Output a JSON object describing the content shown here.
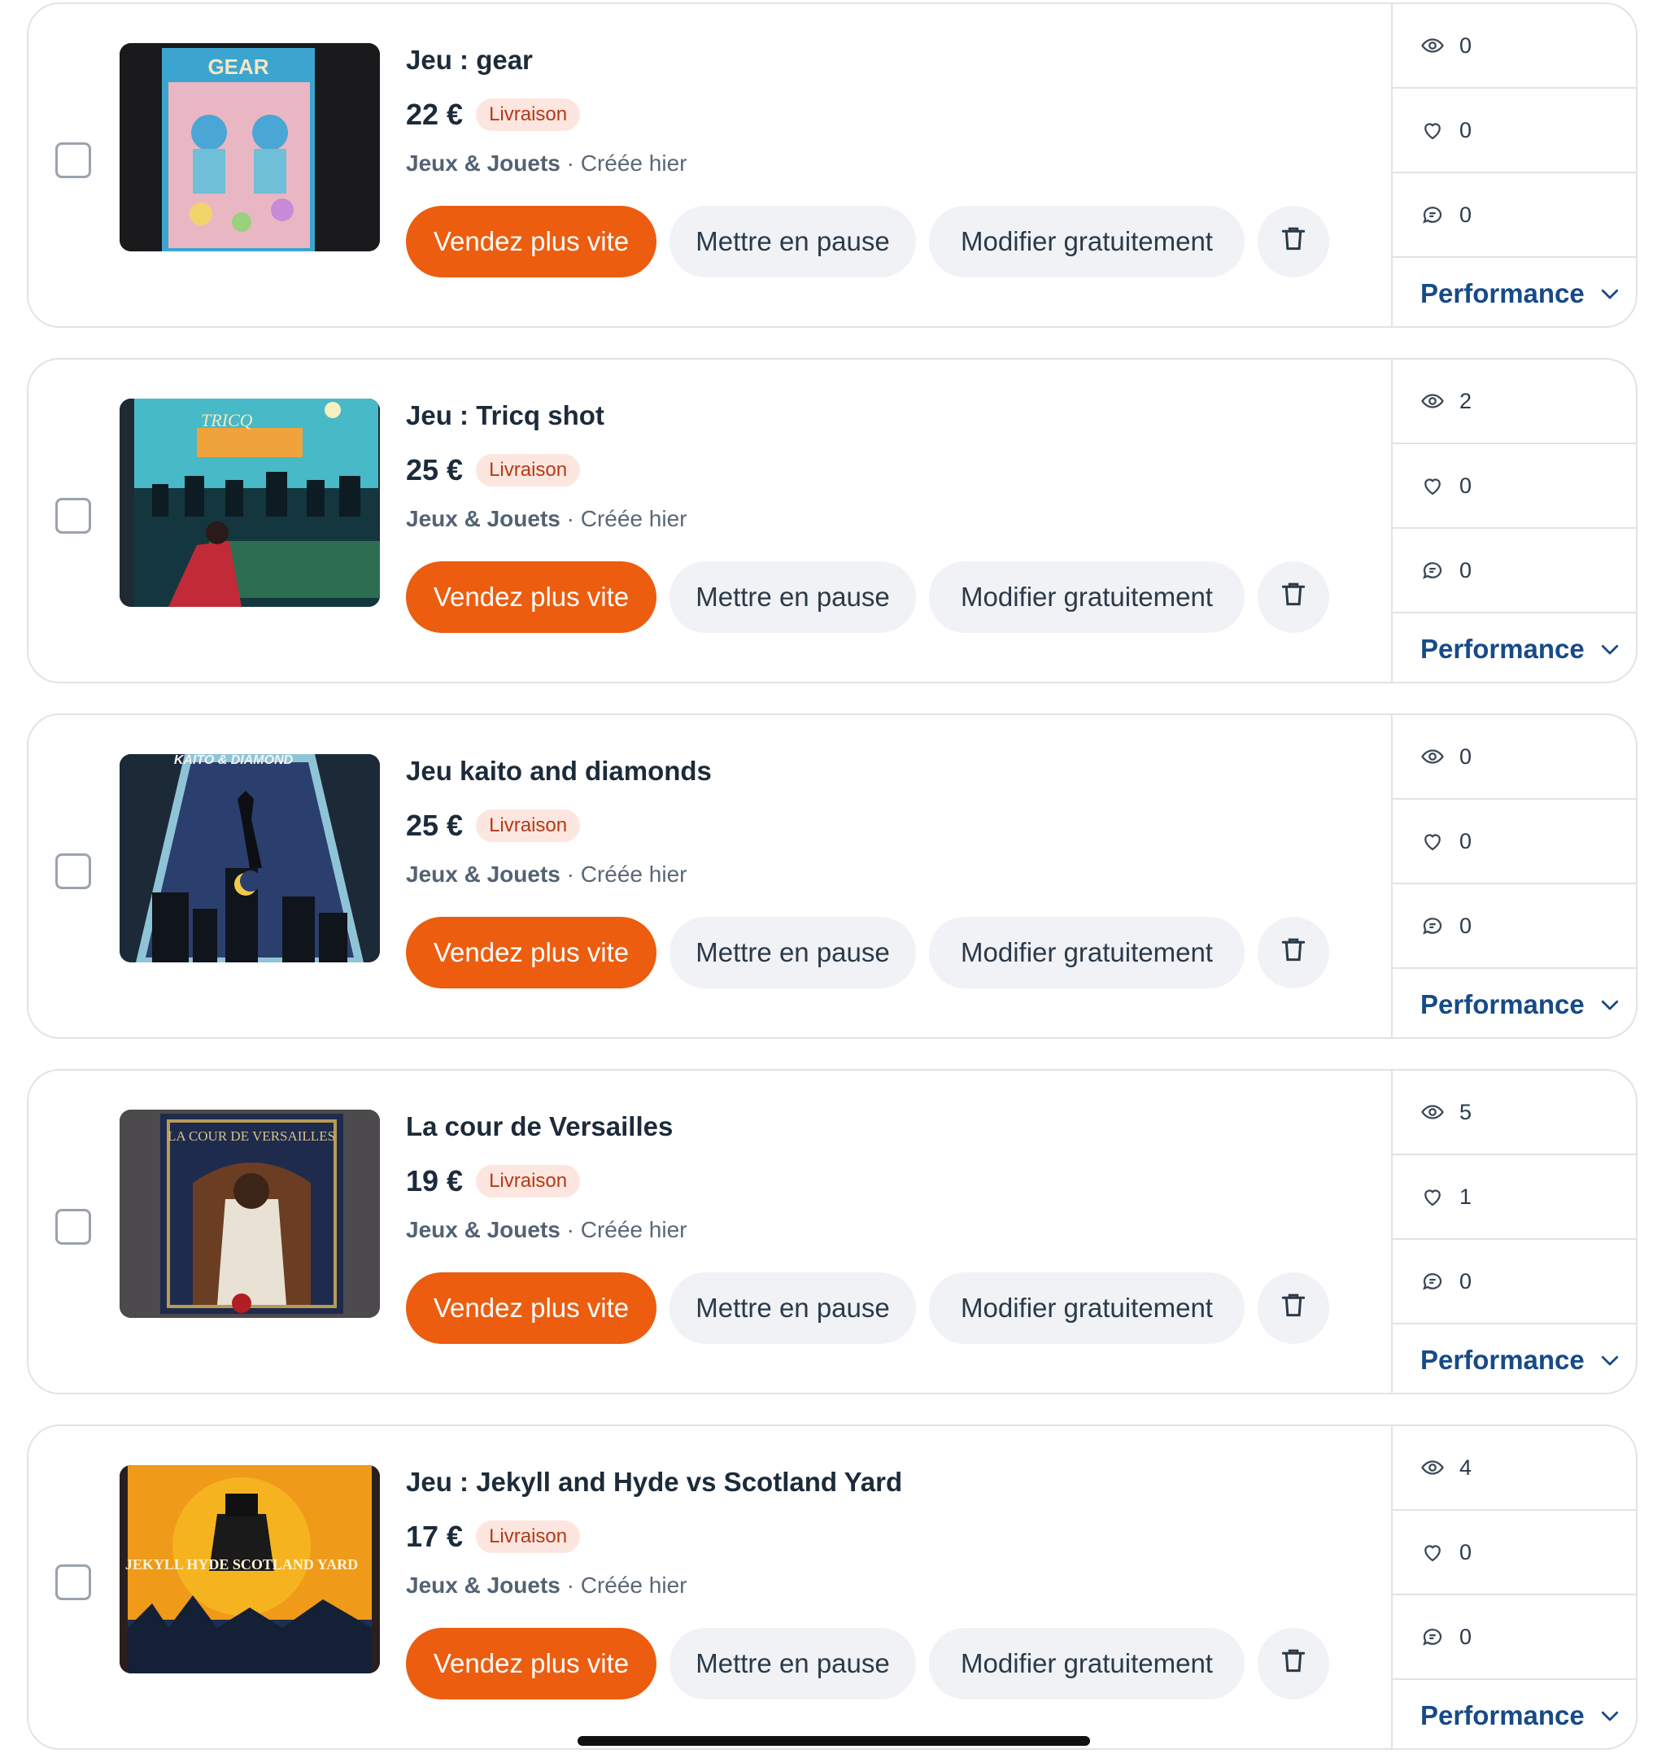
{
  "listings": [
    {
      "title": "Jeu : gear",
      "price": "22 €",
      "badge": "Livraison",
      "category": "Jeux & Jouets",
      "created": "· Créée hier",
      "thumb_text": "GEAR",
      "thumb_theme": "gear",
      "stats": {
        "views": "0",
        "likes": "0",
        "messages": "0"
      }
    },
    {
      "title": "Jeu : Tricq shot",
      "price": "25 €",
      "badge": "Livraison",
      "category": "Jeux & Jouets",
      "created": "· Créée hier",
      "thumb_text": "TRICQ",
      "thumb_theme": "tricq",
      "stats": {
        "views": "2",
        "likes": "0",
        "messages": "0"
      }
    },
    {
      "title": "Jeu kaito and diamonds",
      "price": "25 €",
      "badge": "Livraison",
      "category": "Jeux & Jouets",
      "created": "· Créée hier",
      "thumb_text": "KAITO & DIAMOND",
      "thumb_theme": "kaito",
      "stats": {
        "views": "0",
        "likes": "0",
        "messages": "0"
      }
    },
    {
      "title": "La cour de Versailles",
      "price": "19 €",
      "badge": "Livraison",
      "category": "Jeux & Jouets",
      "created": "· Créée hier",
      "thumb_text": "LA COUR DE VERSAILLES",
      "thumb_theme": "versailles",
      "stats": {
        "views": "5",
        "likes": "1",
        "messages": "0"
      }
    },
    {
      "title": "Jeu : Jekyll and Hyde vs Scotland Yard",
      "price": "17 €",
      "badge": "Livraison",
      "category": "Jeux & Jouets",
      "created": "· Créée hier",
      "thumb_text": "JEKYLL HYDE SCOTLAND YARD",
      "thumb_theme": "jekyll",
      "stats": {
        "views": "4",
        "likes": "0",
        "messages": "0"
      }
    }
  ],
  "labels": {
    "sell_faster": "Vendez plus vite",
    "pause": "Mettre en pause",
    "edit": "Modifier gratuitement",
    "performance": "Performance"
  },
  "icons": {
    "views": "eye-icon",
    "likes": "heart-icon",
    "messages": "chat-bubble-icon",
    "delete": "trash-icon",
    "expand": "chevron-down-icon"
  },
  "colors": {
    "primary": "#ec5d10",
    "badge_bg": "#fde6df",
    "badge_text": "#b43a17",
    "link": "#174a88"
  }
}
